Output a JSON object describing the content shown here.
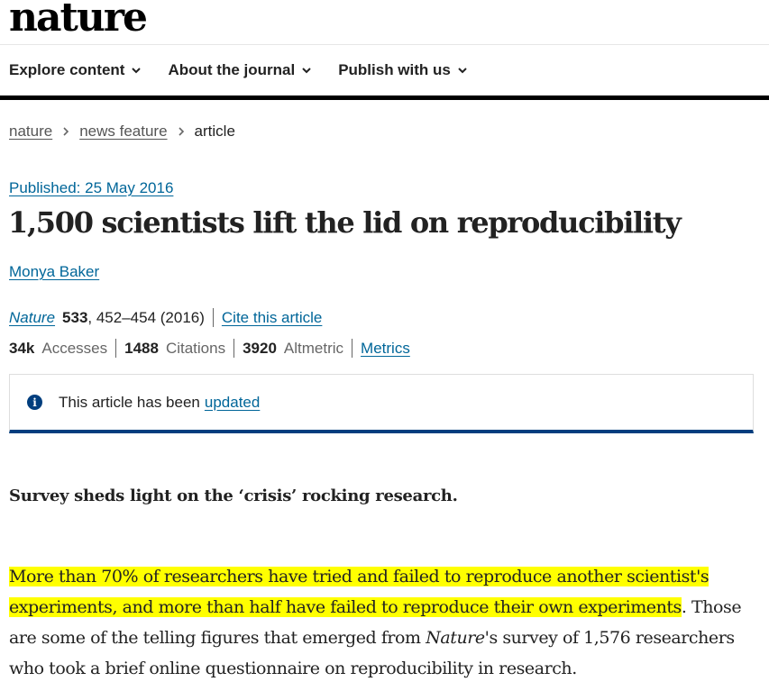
{
  "logo": "nature",
  "nav": {
    "items": [
      "Explore content",
      "About the journal",
      "Publish with us"
    ]
  },
  "breadcrumb": {
    "items": [
      "nature",
      "news feature"
    ],
    "current": "article"
  },
  "article": {
    "published": "Published: 25 May 2016",
    "title": "1,500 scientists lift the lid on reproducibility",
    "author": "Monya Baker",
    "journal": "Nature",
    "volume": "533",
    "pages": ", 452–454 (2016)",
    "cite_label": "Cite this article",
    "metrics": {
      "accesses_value": "34k",
      "accesses_label": "Accesses",
      "citations_value": "1488",
      "citations_label": "Citations",
      "altmetric_value": "3920",
      "altmetric_label": "Altmetric",
      "metrics_link": "Metrics"
    },
    "notice": {
      "icon": "info-icon",
      "text": "This article has been",
      "link": "updated"
    },
    "standfirst": "Survey sheds light on the ‘crisis’ rocking research.",
    "paragraph": {
      "highlighted": "More than 70% of researchers have tried and failed to reproduce another scientist's experiments, and more than half have failed to reproduce their own experiments",
      "rest_1": ". Those are some of the telling figures that emerged from ",
      "italic": "Nature",
      "rest_2": "'s survey of 1,576 researchers who took a brief online questionnaire on reproducibility in research."
    }
  },
  "colors": {
    "link": "#006699",
    "notice_border": "#003e7e",
    "highlight": "#ffff00"
  }
}
